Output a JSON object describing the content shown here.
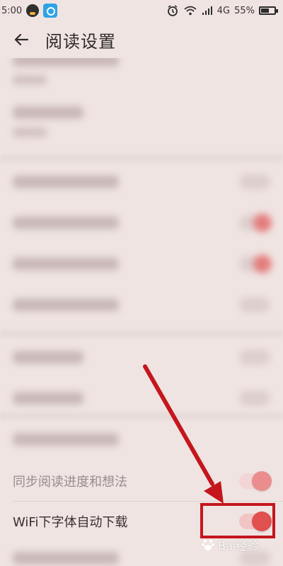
{
  "status_bar": {
    "time": "5:00",
    "network": "4G",
    "battery": "55%"
  },
  "header": {
    "title": "阅读设置"
  },
  "settings": {
    "sync_progress_label": "同步阅读进度和想法",
    "wifi_font_download_label": "WiFi下字体自动下载",
    "wifi_font_download_enabled": true
  },
  "watermark": {
    "text": "Bai经验"
  },
  "colors": {
    "background": "#efe4e2",
    "toggle_on": "#e0504f",
    "annotation": "#c4161c"
  }
}
